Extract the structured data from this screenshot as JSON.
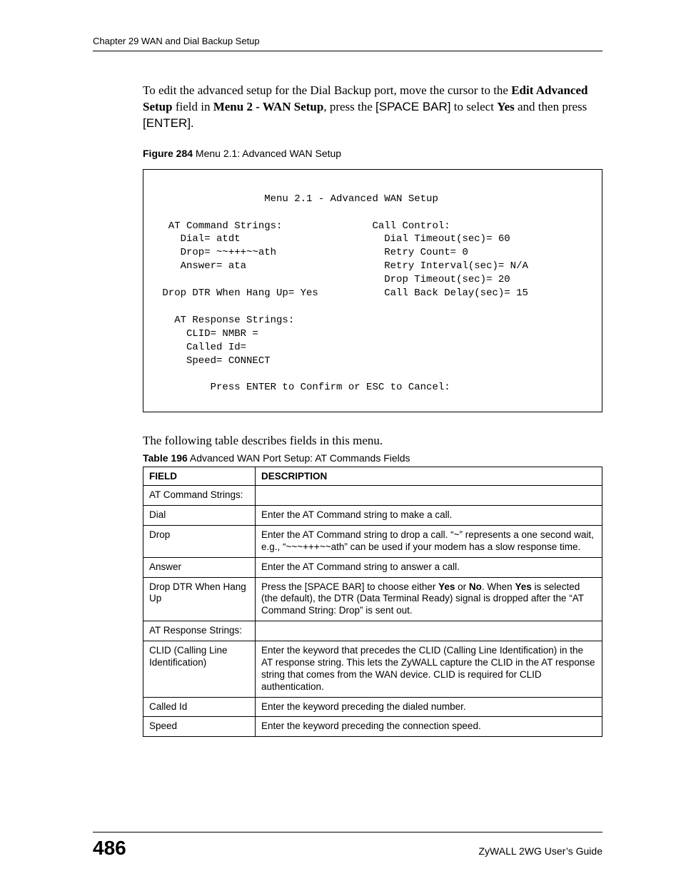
{
  "header": {
    "running_title": "Chapter 29 WAN and Dial Backup Setup"
  },
  "intro": {
    "prefix": "To edit the advanced setup for the Dial Backup port, move the cursor to the ",
    "bold1": "Edit Advanced Setup",
    "mid1": " field in ",
    "bold2": "Menu 2 - WAN Setup",
    "mid2": ", press the ",
    "key1": "[SPACE BAR]",
    "mid3": " to select ",
    "bold3": "Yes",
    "mid4": " and then press ",
    "key2": "[ENTER]",
    "suffix": "."
  },
  "figure": {
    "label": "Figure 284",
    "caption_rest": "   Menu 2.1: Advanced WAN Setup",
    "menu_text": "                  Menu 2.1 - Advanced WAN Setup\n\n  AT Command Strings:               Call Control:\n    Dial= atdt                        Dial Timeout(sec)= 60\n    Drop= ~~+++~~ath                  Retry Count= 0\n    Answer= ata                       Retry Interval(sec)= N/A\n                                      Drop Timeout(sec)= 20\n Drop DTR When Hang Up= Yes           Call Back Delay(sec)= 15\n\n   AT Response Strings:\n     CLID= NMBR =\n     Called Id=\n     Speed= CONNECT\n\n         Press ENTER to Confirm or ESC to Cancel:"
  },
  "table_section": {
    "intro_text": "The following table describes fields in this menu.",
    "label": "Table 196",
    "caption_rest": "   Advanced WAN Port Setup: AT Commands Fields",
    "headers": {
      "c1": "FIELD",
      "c2": "DESCRIPTION"
    },
    "rows": [
      {
        "field": "AT Command Strings:",
        "desc": ""
      },
      {
        "field": "Dial",
        "desc": "Enter the AT Command string to make a call."
      },
      {
        "field": "Drop",
        "desc": "Enter the AT Command string to drop a call. “~” represents a one second wait, e.g., “~~~+++~~ath” can be used if your modem has a slow response time."
      },
      {
        "field": "Answer",
        "desc": "Enter the AT Command string to answer a call."
      },
      {
        "field": "Drop DTR When Hang Up",
        "desc_parts": {
          "p1": "Press the [SPACE BAR] to choose either ",
          "b1": "Yes",
          "p2": " or ",
          "b2": "No",
          "p3": ". When ",
          "b3": "Yes",
          "p4": " is selected (the default), the DTR (Data Terminal Ready) signal is dropped after the “AT Command String: Drop” is sent out."
        }
      },
      {
        "field": "AT Response Strings:",
        "desc": ""
      },
      {
        "field": "CLID (Calling Line Identification)",
        "desc": "Enter the keyword that precedes the CLID (Calling Line Identification) in the AT response string. This lets the ZyWALL capture the CLID in the AT response string that comes from the WAN device. CLID is required for CLID authentication."
      },
      {
        "field": "Called Id",
        "desc": "Enter the keyword preceding the dialed number."
      },
      {
        "field": "Speed",
        "desc": "Enter the keyword preceding the connection speed."
      }
    ]
  },
  "footer": {
    "page_number": "486",
    "guide": "ZyWALL 2WG User’s Guide"
  }
}
